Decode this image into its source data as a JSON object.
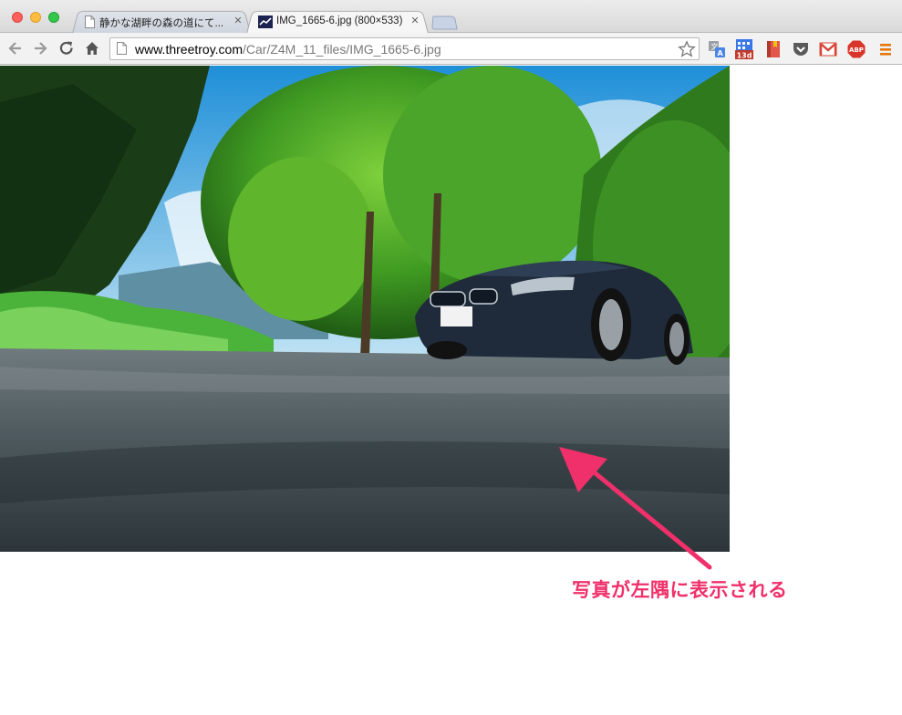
{
  "window": {
    "traffic_lights": [
      "close",
      "minimize",
      "zoom"
    ]
  },
  "tabs": [
    {
      "title": "静かな湖畔の森の道にて...",
      "favicon": "page-icon",
      "active": false
    },
    {
      "title": "IMG_1665-6.jpg (800×533)",
      "favicon": "image-thumbnail-icon",
      "active": true
    }
  ],
  "toolbar": {
    "url_host": "www.threetroy.com",
    "url_path": "/Car/Z4M_11_files/IMG_1665-6.jpg",
    "calendar_badge": "13d",
    "abp_label": "ABP"
  },
  "content": {
    "image_file": "IMG_1665-6.jpg",
    "image_dimensions": "800×533",
    "annotation": "写真が左隅に表示される"
  },
  "colors": {
    "annotation": "#f0306a",
    "titlebar": "#e4e4e4",
    "toolbar": "#f2f2f2"
  }
}
